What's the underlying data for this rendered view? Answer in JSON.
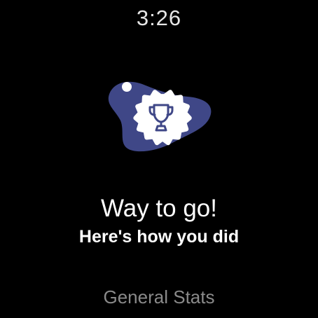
{
  "status_bar": {
    "time": "3:26"
  },
  "summary": {
    "icon": "trophy-icon",
    "headline": "Way to go!",
    "subline": "Here's how you did",
    "section_label": "General Stats"
  },
  "colors": {
    "background": "#000000",
    "blob": "#3f4787",
    "badge": "#ffffff",
    "trophy": "#3f4787",
    "section_label": "#8a8a8a"
  }
}
